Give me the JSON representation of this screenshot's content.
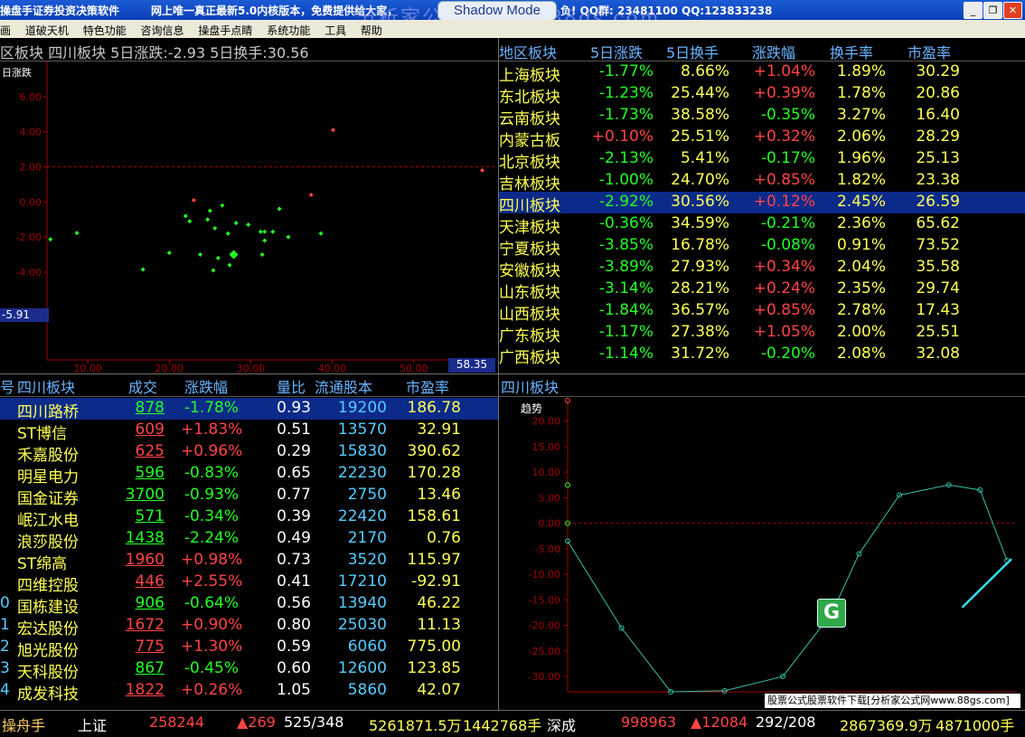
{
  "window": {
    "title": "操盘手证券投资决策软件",
    "notice": "网上唯一真正最新5.0内核版本，免费提供给大家，",
    "qq_info": "负! QQ群: 23481100 QQ:123833238",
    "shadow_mode": "Shadow Mode",
    "watermark": "分析家公式网www.88gs.com",
    "buttons": {
      "minimize": "_",
      "restore": "❐",
      "close": "✕"
    }
  },
  "menu": [
    "道破天机",
    "特色功能",
    "咨询信息",
    "操盘手点睛",
    "系统功能",
    "工具",
    "帮助"
  ],
  "menu_prefix": "画",
  "scatter": {
    "header": "区板块  四川板块  5日涨跌:-2.93  5日换手:30.56",
    "y_axis_title": "日涨跌",
    "y_ticks": [
      "6.00",
      "4.00",
      "2.00",
      "0.00",
      "-2.00",
      "-4.00"
    ],
    "x_ticks": [
      "10.00",
      "20.00",
      "30.00",
      "40.00",
      "50.00"
    ],
    "cursor_y": "-5.91",
    "cursor_x": "58.35",
    "chart_data": {
      "type": "scatter",
      "xlim": [
        5,
        60
      ],
      "ylim": [
        -9,
        8
      ],
      "points": [
        {
          "x": 5.41,
          "y": -2.13,
          "c": "green"
        },
        {
          "x": 8.66,
          "y": -1.77,
          "c": "green"
        },
        {
          "x": 16.78,
          "y": -3.85,
          "c": "green"
        },
        {
          "x": 21.5,
          "y": 8.1,
          "c": "red"
        },
        {
          "x": 20.0,
          "y": -2.9,
          "c": "green"
        },
        {
          "x": 22.0,
          "y": -0.8,
          "c": "green"
        },
        {
          "x": 22.5,
          "y": -1.1,
          "c": "green"
        },
        {
          "x": 23.0,
          "y": 0.1,
          "c": "red"
        },
        {
          "x": 23.8,
          "y": -3.0,
          "c": "green"
        },
        {
          "x": 24.7,
          "y": -1.0,
          "c": "green"
        },
        {
          "x": 25.0,
          "y": -0.5,
          "c": "green"
        },
        {
          "x": 25.4,
          "y": -3.9,
          "c": "green"
        },
        {
          "x": 25.6,
          "y": -1.5,
          "c": "green"
        },
        {
          "x": 26.0,
          "y": -3.2,
          "c": "green"
        },
        {
          "x": 26.5,
          "y": -0.2,
          "c": "green"
        },
        {
          "x": 27.2,
          "y": -1.8,
          "c": "green"
        },
        {
          "x": 27.4,
          "y": -3.6,
          "c": "green"
        },
        {
          "x": 27.9,
          "y": -3.0,
          "c": "green",
          "big": true
        },
        {
          "x": 28.2,
          "y": -1.2,
          "c": "green"
        },
        {
          "x": 29.7,
          "y": -1.3,
          "c": "green"
        },
        {
          "x": 31.2,
          "y": -1.7,
          "c": "green"
        },
        {
          "x": 31.4,
          "y": -3.0,
          "c": "green"
        },
        {
          "x": 31.7,
          "y": -1.7,
          "c": "green"
        },
        {
          "x": 31.7,
          "y": -2.2,
          "c": "green"
        },
        {
          "x": 32.7,
          "y": -1.7,
          "c": "green"
        },
        {
          "x": 34.6,
          "y": -2.0,
          "c": "green"
        },
        {
          "x": 33.5,
          "y": -0.4,
          "c": "green"
        },
        {
          "x": 37.4,
          "y": 0.4,
          "c": "red"
        },
        {
          "x": 38.6,
          "y": -1.8,
          "c": "green"
        },
        {
          "x": 40.1,
          "y": 4.1,
          "c": "red"
        },
        {
          "x": 58.4,
          "y": 1.8,
          "c": "red"
        }
      ]
    }
  },
  "region_table": {
    "headers": [
      "地区板块",
      "5日涨跌",
      "5日换手",
      "涨跌幅",
      "换手率",
      "市盈率"
    ],
    "rows": [
      [
        "上海板块",
        "-1.77%",
        "8.66%",
        "+1.04%",
        "1.89%",
        "30.29"
      ],
      [
        "东北板块",
        "-1.23%",
        "25.44%",
        "+0.39%",
        "1.78%",
        "20.86"
      ],
      [
        "云南板块",
        "-1.73%",
        "38.58%",
        "-0.35%",
        "3.27%",
        "16.40"
      ],
      [
        "内蒙古板",
        "+0.10%",
        "25.51%",
        "+0.32%",
        "2.06%",
        "28.29"
      ],
      [
        "北京板块",
        "-2.13%",
        "5.41%",
        "-0.17%",
        "1.96%",
        "25.13"
      ],
      [
        "吉林板块",
        "-1.00%",
        "24.70%",
        "+0.85%",
        "1.82%",
        "23.38"
      ],
      [
        "四川板块",
        "-2.92%",
        "30.56%",
        "+0.12%",
        "2.45%",
        "26.59"
      ],
      [
        "天津板块",
        "-0.36%",
        "34.59%",
        "-0.21%",
        "2.36%",
        "65.62"
      ],
      [
        "宁夏板块",
        "-3.85%",
        "16.78%",
        "-0.08%",
        "0.91%",
        "73.52"
      ],
      [
        "安徽板块",
        "-3.89%",
        "27.93%",
        "+0.34%",
        "2.04%",
        "35.58"
      ],
      [
        "山东板块",
        "-3.14%",
        "28.21%",
        "+0.24%",
        "2.35%",
        "29.74"
      ],
      [
        "山西板块",
        "-1.84%",
        "36.57%",
        "+0.85%",
        "2.78%",
        "17.43"
      ],
      [
        "广东板块",
        "-1.17%",
        "27.38%",
        "+1.05%",
        "2.00%",
        "25.51"
      ],
      [
        "广西板块",
        "-1.14%",
        "31.72%",
        "-0.20%",
        "2.08%",
        "32.08"
      ]
    ],
    "selected": 6
  },
  "stock_table": {
    "headers": [
      "号",
      "四川板块",
      "成交",
      "涨跌幅",
      "量比",
      "流通股本",
      "市盈率"
    ],
    "rows": [
      [
        "",
        "四川路桥",
        "878",
        "-1.78%",
        "0.93",
        "19200",
        "186.78"
      ],
      [
        "",
        "ST博信",
        "609",
        "+1.83%",
        "0.51",
        "13570",
        "32.91"
      ],
      [
        "",
        "禾嘉股份",
        "625",
        "+0.96%",
        "0.29",
        "15830",
        "390.62"
      ],
      [
        "",
        "明星电力",
        "596",
        "-0.83%",
        "0.65",
        "22230",
        "170.28"
      ],
      [
        "",
        "国金证券",
        "3700",
        "-0.93%",
        "0.77",
        "2750",
        "13.46"
      ],
      [
        "",
        "岷江水电",
        "571",
        "-0.34%",
        "0.39",
        "22420",
        "158.61"
      ],
      [
        "",
        "浪莎股份",
        "1438",
        "-2.24%",
        "0.49",
        "2170",
        "0.76"
      ],
      [
        "",
        "ST绵高",
        "1960",
        "+0.98%",
        "0.73",
        "3520",
        "115.97"
      ],
      [
        "",
        "四维控股",
        "446",
        "+2.55%",
        "0.41",
        "17210",
        "-92.91"
      ],
      [
        "0",
        "国栋建设",
        "906",
        "-0.64%",
        "0.56",
        "13940",
        "46.22"
      ],
      [
        "1",
        "宏达股份",
        "1672",
        "+0.90%",
        "0.80",
        "25030",
        "11.13"
      ],
      [
        "2",
        "旭光股份",
        "775",
        "+1.30%",
        "0.59",
        "6060",
        "775.00"
      ],
      [
        "3",
        "天科股份",
        "867",
        "-0.45%",
        "0.60",
        "12600",
        "123.85"
      ],
      [
        "4",
        "成发科技",
        "1822",
        "+0.26%",
        "1.05",
        "5860",
        "42.07"
      ]
    ],
    "selected": 0
  },
  "trend": {
    "header": "四川板块",
    "label": "趋势",
    "y_ticks": [
      "20.00",
      "15.00",
      "10.00",
      "5.00",
      "0.00",
      "-5.00",
      "-10.00",
      "-15.00",
      "-20.00",
      "-25.00",
      "-30.00"
    ],
    "x_ticks": [
      "5.00"
    ],
    "chart_data": {
      "type": "line",
      "ylim": [
        -33,
        24
      ],
      "xlim": [
        0,
        10
      ],
      "line": [
        {
          "x": 0.0,
          "y": -3.5
        },
        {
          "x": 1.2,
          "y": -20.5
        },
        {
          "x": 2.3,
          "y": -33.0
        },
        {
          "x": 3.5,
          "y": -32.8
        },
        {
          "x": 4.8,
          "y": -30.0
        },
        {
          "x": 5.9,
          "y": -17.5
        },
        {
          "x": 6.5,
          "y": -6.0
        },
        {
          "x": 7.4,
          "y": 5.5
        },
        {
          "x": 8.5,
          "y": 7.5
        },
        {
          "x": 9.2,
          "y": 6.5
        },
        {
          "x": 9.8,
          "y": -7.3
        }
      ],
      "markers": [
        {
          "x": 0.0,
          "y": 24.0,
          "c": "red"
        },
        {
          "x": 0.0,
          "y": 7.5,
          "c": "green"
        },
        {
          "x": 0.0,
          "y": 0.0,
          "c": "green"
        }
      ],
      "hint": {
        "x0": 8.8,
        "y0": -16.5,
        "x1": 9.9,
        "y1": -7.0
      }
    }
  },
  "ad_text": "股票公式股票软件下载[分析家公式网www.88gs.com]",
  "status": {
    "lead": "操舟手",
    "sh_label": "上证",
    "sh_index": "258244",
    "sh_change": "▲269",
    "sh_updown": "525/348",
    "sh_amount": "5261871.5万",
    "sh_volume": "1442768手",
    "sz_label": "深成",
    "sz_index": "998963",
    "sz_change": "▲12084",
    "sz_updown": "292/208",
    "sz_amount": "2867369.9万",
    "sz_volume": "4871000手"
  },
  "colors": {
    "green": "#22ff22",
    "red": "#ff4444",
    "yellow": "#ffff54",
    "gridred": "#a00000"
  }
}
